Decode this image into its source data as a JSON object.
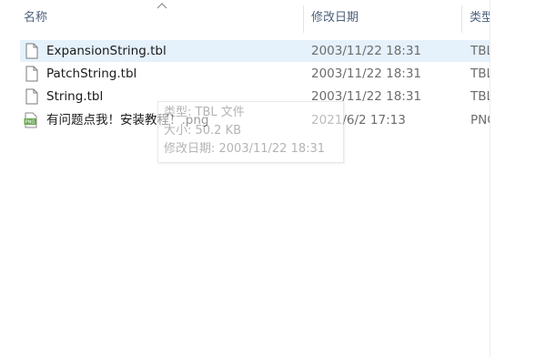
{
  "columns": {
    "name": "名称",
    "date_modified": "修改日期",
    "type": "类型"
  },
  "files": [
    {
      "name": "ExpansionString.tbl",
      "date": "2003/11/22 18:31",
      "type": "TBL 文件",
      "icon": "document-icon",
      "selected": true
    },
    {
      "name": "PatchString.tbl",
      "date": "2003/11/22 18:31",
      "type": "TBL 文件",
      "icon": "document-icon",
      "selected": false
    },
    {
      "name": "String.tbl",
      "date": "2003/11/22 18:31",
      "type": "TBL 文件",
      "icon": "document-icon",
      "selected": false
    },
    {
      "name": "有问题点我！安装教程！.png",
      "date": "2021/6/2 17:13",
      "type": "PNG 文件",
      "icon": "png-image-icon",
      "selected": false
    }
  ],
  "tooltip": {
    "type_line": "类型: TBL 文件",
    "size_line": "大小: 50.2 KB",
    "date_line": "修改日期: 2003/11/22 18:31"
  },
  "colors": {
    "selection": "#e5f1fb",
    "header_text": "#4c607a",
    "png_icon": "#6aa84f"
  }
}
